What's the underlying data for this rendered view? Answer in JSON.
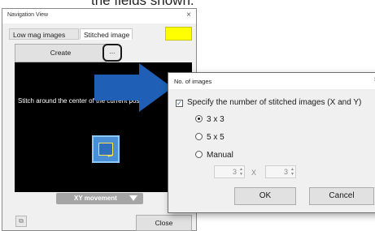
{
  "caption": "the fields shown.",
  "nav_window": {
    "title": "Navigation View",
    "close_glyph": "×",
    "tabs": [
      {
        "label": "Low mag images",
        "active": false
      },
      {
        "label": "Stitched image",
        "active": true
      }
    ],
    "swatch_color": "#ffff00",
    "create_label": "Create",
    "ellipsis_label": "...",
    "preview_text": "Stitch around the center of the current position",
    "thumbnail_icon": "stitch-thumbnail-icon",
    "xy_movement_label": "XY movement",
    "close_label": "Close"
  },
  "arrow_color": "#1f5fb5",
  "dialog": {
    "title": "No. of images",
    "close_glyph": "×",
    "specify_label": "Specify the number of stitched images (X and Y)",
    "specify_checked": true,
    "options": [
      {
        "label": "3 x 3",
        "selected": true
      },
      {
        "label": "5 x 5",
        "selected": false
      },
      {
        "label": "Manual",
        "selected": false
      }
    ],
    "manual_x": "3",
    "manual_y": "3",
    "times_label": "X",
    "ok_label": "OK",
    "cancel_label": "Cancel"
  }
}
